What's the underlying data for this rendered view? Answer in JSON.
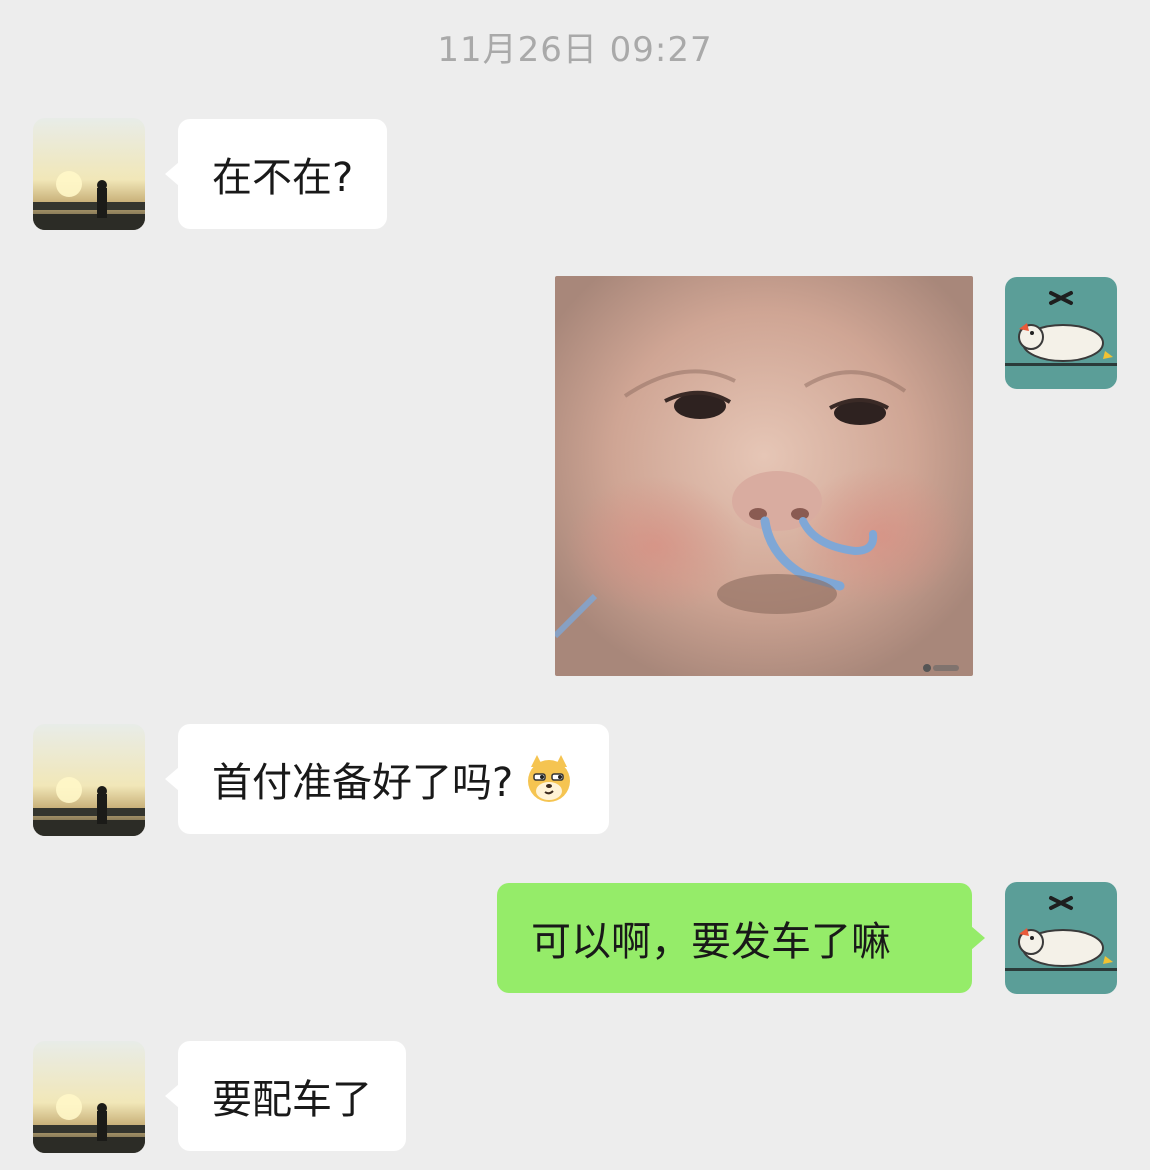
{
  "chat": {
    "timestamp": "11月26日 09:27",
    "messages": [
      {
        "sender": "contact",
        "type": "text",
        "text": "在不在?"
      },
      {
        "sender": "me",
        "type": "sticker",
        "sticker_name": "baby-runny-nose-sticker"
      },
      {
        "sender": "contact",
        "type": "text",
        "text": "首付准备好了吗?",
        "emoji": "dog-smirk-emoji"
      },
      {
        "sender": "me",
        "type": "text",
        "text": "可以啊，要发车了嘛"
      },
      {
        "sender": "contact",
        "type": "text",
        "text": "要配车了"
      }
    ]
  },
  "colors": {
    "background": "#ededed",
    "incoming_bubble": "#ffffff",
    "outgoing_bubble": "#95ec69",
    "timestamp_text": "#a9a9a9"
  },
  "avatars": {
    "contact": "sunset-silhouette-avatar",
    "me": "cartoon-duck-avatar"
  }
}
